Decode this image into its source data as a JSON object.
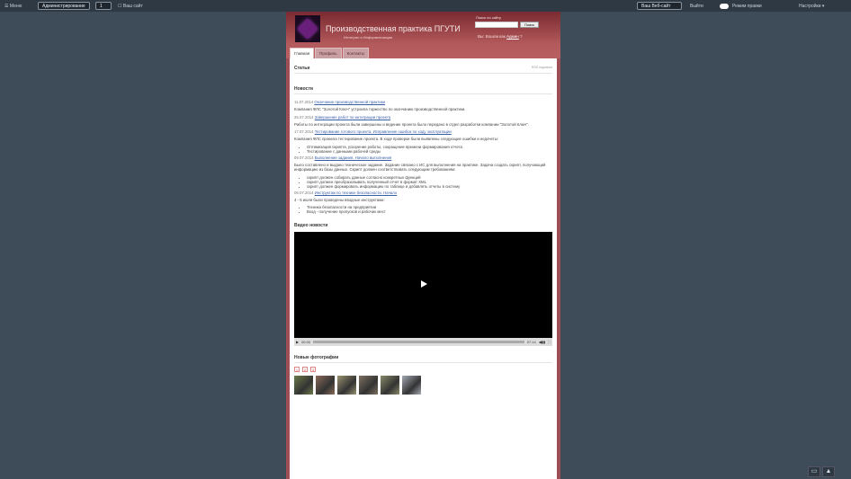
{
  "topbar": {
    "menu": "Меню",
    "mode": "Администрирование",
    "stepper": "1",
    "note": "Ваш сайт",
    "browser_btn": "Ваш Веб-сайт",
    "item": "Выйти",
    "toggle_label": "Режим правки",
    "right": "Настройки"
  },
  "site": {
    "title": "Производственная практика ПГУТИ",
    "subtitle": "Интеграл и Информатизация",
    "search_label": "Поиск по сайту",
    "search_placeholder": "",
    "search_button": "Поиск",
    "login_text": "Вы: Вошли как",
    "login_user": "Админ"
  },
  "tabs": [
    {
      "label": "Главная"
    },
    {
      "label": "Профиль"
    },
    {
      "label": "Контакты"
    }
  ],
  "content": {
    "page_title": "Статьи",
    "rss": "RSS подписка",
    "news_heading": "Новости",
    "news": [
      {
        "date": "11.07.2014",
        "title": "Окончание производственной практики",
        "text": "Компания ФЛС \"Золотой Ключ\" устроила торжество по окончанию производственной практики."
      },
      {
        "date": "25.07.2014",
        "title": "Завершение работ по интеграции проекта",
        "text": "Работы по интеграции проекта были завершены и ведение проекта было передано в отдел разработки компании \"Золотой Ключ\"."
      },
      {
        "date": "17.07.2014",
        "title": "Тестирование готового проекта. Исправление ошибок по ходу эксплуатации",
        "text": "Компания ФЛС провела тестирование проекта. В ходе проверки были выявлены следующие ошибки и недочеты:",
        "items": [
          "Оптимизация скрипта, ускорение работы, сокращение времени формирования отчета",
          "Тестирование с данными рабочей среды"
        ]
      },
      {
        "date": "09.07.2014",
        "title": "Выполнение задания. Начало выполнения",
        "text": "Было составлено и выдано техническое задание. Задание связано с ИС для выполнения на практике. Задача создать скрипт, получающий информацию из базы данных. Скрипт должен соответствовать следующим требованиям:",
        "items": [
          "скрипт должен собирать данные согласно конкретных функций",
          "скрипт должен преобразовывать полученный отчет в формат XML",
          "скрипт должен формировать информацию по таблице и добавлять отчеты в систему"
        ]
      },
      {
        "date": "09.07.2014",
        "title": "Инструктаж по технике безопасности. Начало",
        "text": "4 - 5 июля были проведены вводные инструктажи:",
        "items": [
          "Техника безопасности на предприятии",
          "Вход - получение пропусков и рабочих мест"
        ]
      }
    ],
    "video_heading": "Видео новости",
    "video": {
      "time_current": "00:00",
      "time_total": "07:14"
    },
    "photos_heading": "Новые фотографии",
    "pager": [
      "1",
      "2",
      "3"
    ],
    "photos": [
      "#6c7a4a",
      "#8a6a58",
      "#9a9270",
      "#7e7060",
      "#8a8a6a",
      "#a4aab4"
    ]
  }
}
